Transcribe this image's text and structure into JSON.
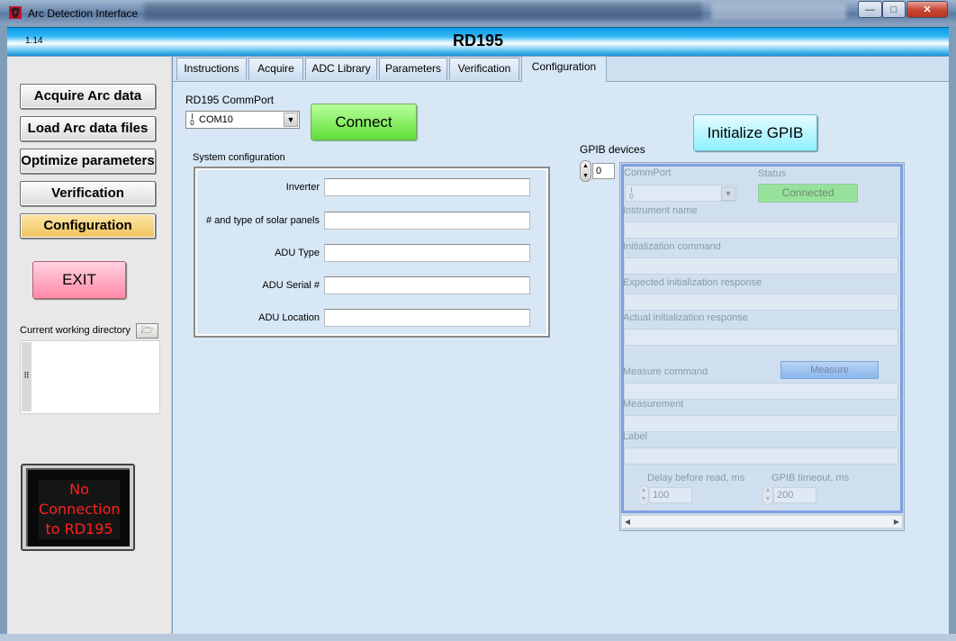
{
  "window": {
    "title": "Arc Detection Interface",
    "controls": {
      "minimize": "—",
      "maximize": "□",
      "close": "✕"
    }
  },
  "header": {
    "version": "1.14",
    "title": "RD195"
  },
  "sidebar": {
    "buttons": [
      {
        "label": "Acquire Arc data",
        "active": false
      },
      {
        "label": "Load Arc data files",
        "active": false
      },
      {
        "label": "Optimize parameters",
        "active": false
      },
      {
        "label": "Verification",
        "active": false
      },
      {
        "label": "Configuration",
        "active": true
      }
    ],
    "exit_label": "EXIT",
    "cwd_label": "Current working directory",
    "cwd_value": "",
    "status_lines": [
      "No",
      "Connection",
      "to RD195"
    ]
  },
  "tabs": [
    {
      "label": "Instructions",
      "active": false
    },
    {
      "label": "Acquire",
      "active": false
    },
    {
      "label": "ADC Library",
      "active": false
    },
    {
      "label": "Parameters",
      "active": false
    },
    {
      "label": "Verification",
      "active": false
    },
    {
      "label": "Configuration",
      "active": true
    }
  ],
  "config": {
    "commport_label": "RD195 CommPort",
    "commport_value": "COM10",
    "connect_label": "Connect",
    "system_config_label": "System configuration",
    "fields": [
      {
        "label": "Inverter",
        "value": ""
      },
      {
        "label": "# and type of solar panels",
        "value": ""
      },
      {
        "label": "ADU Type",
        "value": ""
      },
      {
        "label": "ADU Serial #",
        "value": ""
      },
      {
        "label": "ADU Location",
        "value": ""
      }
    ]
  },
  "gpib": {
    "init_label": "Initialize GPIB",
    "devices_label": "GPIB devices",
    "device_index": "0",
    "commport_label": "CommPort",
    "status_label": "Status",
    "status_value": "Connected",
    "instrument_name_label": "Instrument name",
    "init_command_label": "Initialization command",
    "expected_response_label": "Expected initialization response",
    "actual_response_label": "Actual initialization response",
    "measure_command_label": "Measure command",
    "measure_button": "Measure",
    "measurement_label": "Measurement",
    "label_label": "Label",
    "delay_label": "Delay before read, ms",
    "delay_value": "100",
    "timeout_label": "GPIB timeout, ms",
    "timeout_value": "200"
  },
  "colors": {
    "accent_header": "#2fb6f5",
    "connect_green": "#5fde38",
    "gpib_cyan": "#8fefff",
    "exit_pink": "#ff8aa8",
    "active_nav": "#f1c25b",
    "status_red": "#ff2020"
  }
}
